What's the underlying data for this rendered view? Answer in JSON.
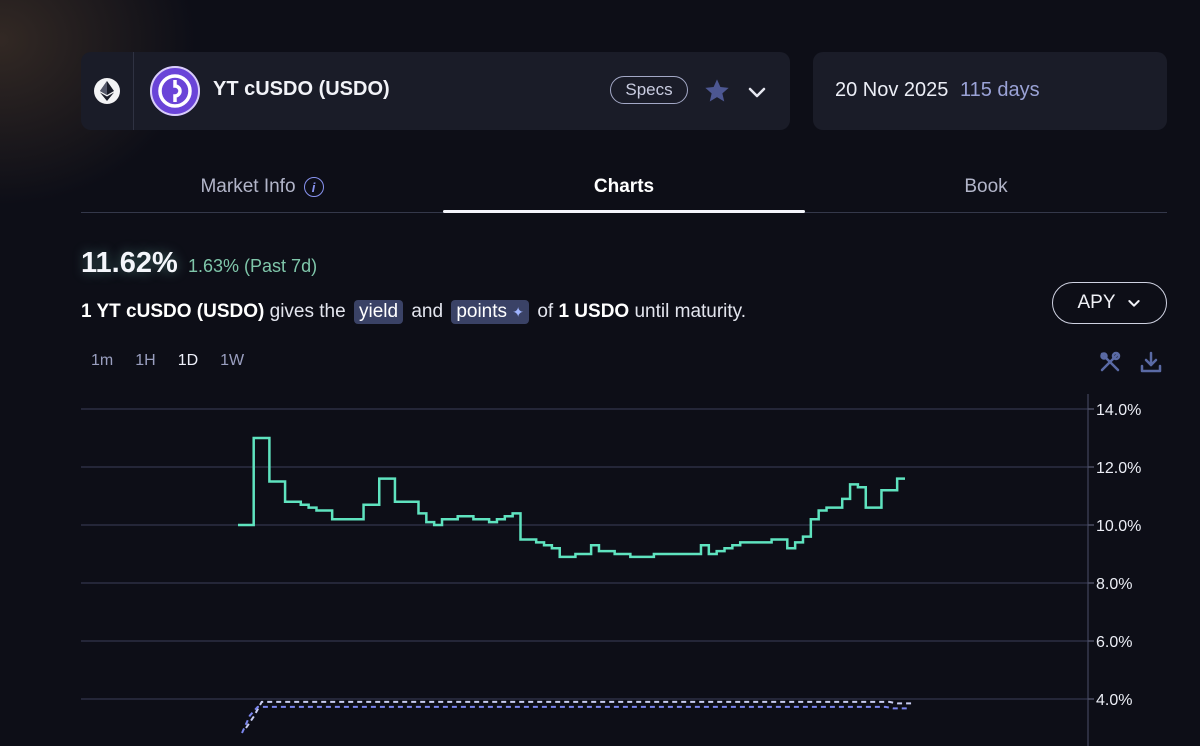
{
  "market": {
    "chain_icon": "ethereum-icon",
    "token_icon": "cusdo-logo-icon",
    "name": "YT cUSDO (USDO)",
    "specs_label": "Specs",
    "favorite_icon": "star-icon",
    "expand_icon": "chevron-down-icon"
  },
  "maturity": {
    "date": "20 Nov 2025",
    "days": "115 days"
  },
  "tabs": [
    {
      "label": "Market Info",
      "icon": "info-icon"
    },
    {
      "label": "Charts",
      "active": true
    },
    {
      "label": "Book"
    }
  ],
  "summary": {
    "apy": "11.62%",
    "change": "1.63% (Past 7d)"
  },
  "description": {
    "amount": "1 YT cUSDO (USDO)",
    "gives_the": "gives the",
    "yield_label": "yield",
    "and": "and",
    "points_label": "points",
    "of": "of",
    "underlying": "1 USDO",
    "suffix": "until maturity."
  },
  "metric_selector": {
    "label": "APY",
    "icon": "chevron-down-icon"
  },
  "intervals": [
    "1m",
    "1H",
    "1D",
    "1W"
  ],
  "active_interval": "1D",
  "tools": [
    "tools-icon",
    "download-icon"
  ],
  "colors": {
    "background": "#0d0e17",
    "card": "#1a1c28",
    "apy_line": "#5fe3bf",
    "reference_line": "#7b86ee",
    "change_text": "#7fc6aa",
    "token_logo": "#6b45d9"
  },
  "chart_data": {
    "type": "line",
    "y_unit": "%",
    "ylim": [
      3.0,
      14.5
    ],
    "yticks": [
      "14.0%",
      "12.0%",
      "10.0%",
      "8.0%",
      "6.0%",
      "4.0%"
    ],
    "grid": true,
    "series": [
      {
        "style": "step",
        "values": [
          10.0,
          10.0,
          13.0,
          13.0,
          11.5,
          11.5,
          10.8,
          10.8,
          10.7,
          10.6,
          10.5,
          10.5,
          10.2,
          10.2,
          10.2,
          10.2,
          10.7,
          10.7,
          11.6,
          11.6,
          10.8,
          10.8,
          10.8,
          10.4,
          10.1,
          10.0,
          10.2,
          10.2,
          10.3,
          10.3,
          10.2,
          10.2,
          10.1,
          10.2,
          10.3,
          10.4,
          9.5,
          9.5,
          9.4,
          9.3,
          9.2,
          8.9,
          8.9,
          9.0,
          9.0,
          9.3,
          9.1,
          9.1,
          9.0,
          9.0,
          8.9,
          8.9,
          8.9,
          9.0,
          9.0,
          9.0,
          9.0,
          9.0,
          9.0,
          9.3,
          9.0,
          9.1,
          9.2,
          9.3,
          9.4,
          9.4,
          9.4,
          9.4,
          9.5,
          9.5,
          9.2,
          9.4,
          9.6,
          10.2,
          10.5,
          10.6,
          10.6,
          10.9,
          11.4,
          11.3,
          10.6,
          10.6,
          11.2,
          11.2,
          11.6,
          11.6
        ]
      },
      {
        "style": "dashed",
        "values": [
          3.0,
          3.4,
          3.9,
          3.9,
          3.9,
          3.9,
          3.9,
          3.9,
          3.9,
          3.9,
          3.9,
          3.9,
          3.9,
          3.9,
          3.9,
          3.9,
          3.9,
          3.9,
          3.9,
          3.9,
          3.9,
          3.9,
          3.9,
          3.9,
          3.9,
          3.9,
          3.9,
          3.9,
          3.9,
          3.9,
          3.9,
          3.9,
          3.9,
          3.9,
          3.9,
          3.9,
          3.9,
          3.9,
          3.9,
          3.9,
          3.9,
          3.9,
          3.9,
          3.9,
          3.9,
          3.9,
          3.9,
          3.9,
          3.9,
          3.9,
          3.9,
          3.9,
          3.9,
          3.9,
          3.9,
          3.9,
          3.9,
          3.9,
          3.9,
          3.9,
          3.9,
          3.9,
          3.9,
          3.9,
          3.9,
          3.9,
          3.9,
          3.9,
          3.9,
          3.9,
          3.9,
          3.9,
          3.9,
          3.9,
          3.9,
          3.9,
          3.9,
          3.9,
          3.9,
          3.9,
          3.9,
          3.9,
          3.9,
          3.85,
          3.85,
          3.85
        ]
      },
      {
        "style": "dashed",
        "values": [
          3.0,
          3.6,
          3.9,
          3.9,
          3.9,
          3.9,
          3.9,
          3.9,
          3.9,
          3.9,
          3.9,
          3.9,
          3.9,
          3.9,
          3.9,
          3.9,
          3.9,
          3.9,
          3.9,
          3.9,
          3.9,
          3.9,
          3.9,
          3.9,
          3.9,
          3.9,
          3.9,
          3.9,
          3.9,
          3.9,
          3.9,
          3.9,
          3.9,
          3.9,
          3.9,
          3.9,
          3.9,
          3.9,
          3.9,
          3.9,
          3.9,
          3.9,
          3.9,
          3.9,
          3.9,
          3.9,
          3.9,
          3.9,
          3.9,
          3.9,
          3.9,
          3.9,
          3.9,
          3.9,
          3.9,
          3.9,
          3.9,
          3.9,
          3.9,
          3.9,
          3.9,
          3.9,
          3.9,
          3.9,
          3.9,
          3.9,
          3.9,
          3.9,
          3.9,
          3.9,
          3.9,
          3.9,
          3.9,
          3.9,
          3.9,
          3.9,
          3.9,
          3.9,
          3.9,
          3.9,
          3.9,
          3.9,
          3.9,
          3.85,
          3.85,
          3.85
        ]
      }
    ]
  }
}
